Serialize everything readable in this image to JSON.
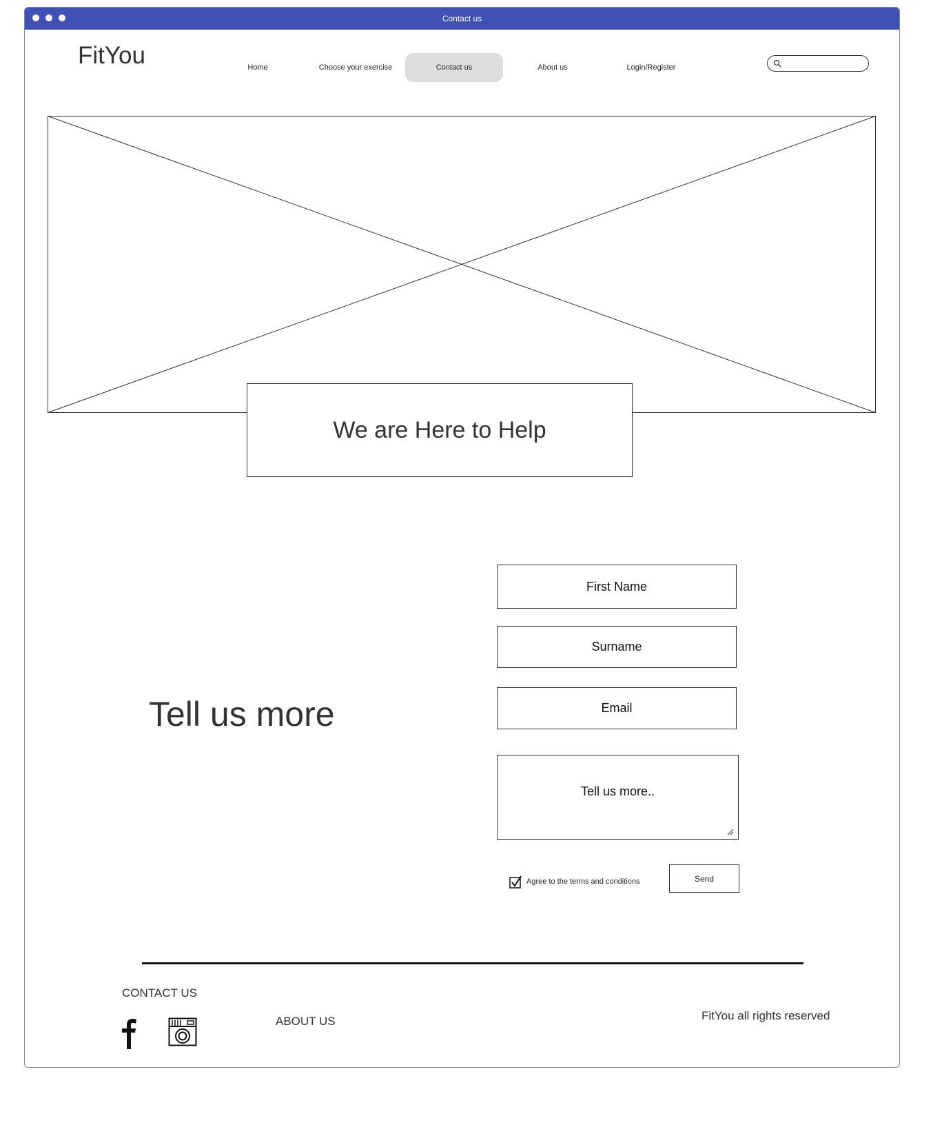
{
  "window": {
    "title": "Contact us",
    "titlebar_color": "#3f51b5"
  },
  "header": {
    "logo": "FitYou",
    "nav": [
      {
        "label": "Home"
      },
      {
        "label": "Choose your exercise"
      },
      {
        "label": "Contact us",
        "active": true
      },
      {
        "label": "About us"
      },
      {
        "label": "Login/Register"
      }
    ],
    "search": {
      "placeholder": "",
      "icon": "search-icon"
    }
  },
  "hero": {
    "image": "image-placeholder",
    "heading": "We are Here to Help"
  },
  "contact_form": {
    "heading": "Tell us more",
    "fields": {
      "first_name": "First Name",
      "surname": "Surname",
      "email": "Email",
      "message": "Tell us more.."
    },
    "terms": {
      "label": "Agree to the terms and conditions",
      "checked": true
    },
    "send_label": "Send"
  },
  "footer": {
    "contact_label": "CONTACT US",
    "about_label": "ABOUT US",
    "rights": "FitYou all rights reserved",
    "social_icons": [
      "facebook-icon",
      "instagram-icon"
    ]
  }
}
